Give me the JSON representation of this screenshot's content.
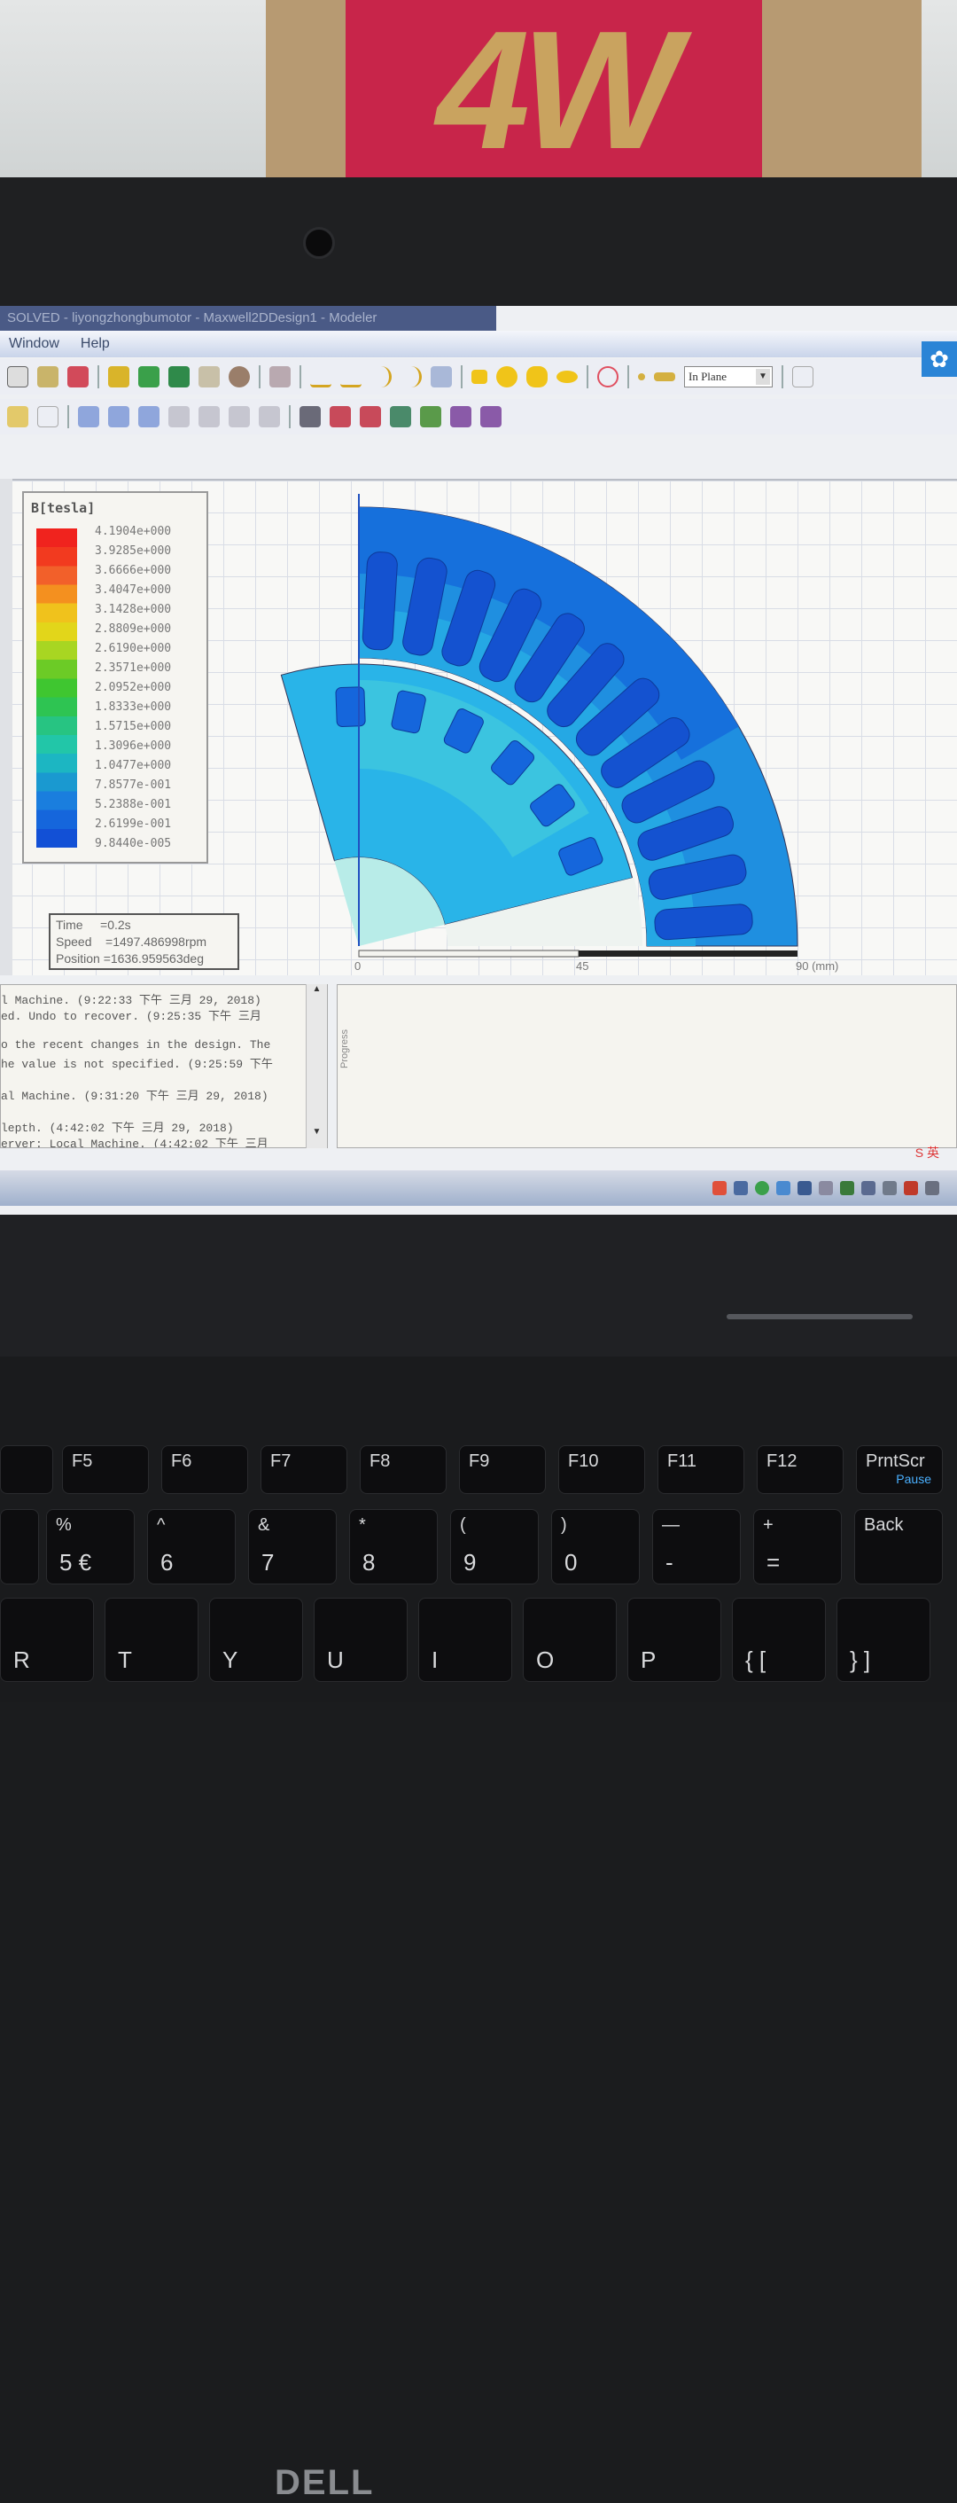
{
  "environment": {
    "box_label": "4W",
    "laptop_brand": "DELL"
  },
  "window": {
    "title": "SOLVED - liyongzhongbumotor - Maxwell2DDesign1 - Modeler"
  },
  "menu": [
    "Window",
    "Help"
  ],
  "toolbar": {
    "plane_select": "In Plane"
  },
  "legend": {
    "title": "B[tesla]",
    "values": [
      "4.1904e+000",
      "3.9285e+000",
      "3.6666e+000",
      "3.4047e+000",
      "3.1428e+000",
      "2.8809e+000",
      "2.6190e+000",
      "2.3571e+000",
      "2.0952e+000",
      "1.8333e+000",
      "1.5715e+000",
      "1.3096e+000",
      "1.0477e+000",
      "7.8577e-001",
      "5.2388e-001",
      "2.6199e-001",
      "9.8440e-005"
    ],
    "colors": [
      "#f0231e",
      "#f23a1f",
      "#f2602a",
      "#f4901f",
      "#f0c21c",
      "#e2d61a",
      "#a8d622",
      "#6ccb26",
      "#3fc630",
      "#2ec452",
      "#27c482",
      "#22c6a8",
      "#1cb6c2",
      "#1a99d0",
      "#1a7ede",
      "#1566dc",
      "#1250d6"
    ]
  },
  "info": {
    "time": "Time     =0.2s",
    "speed": "Speed    =1497.486998rpm",
    "position": "Position =1636.959563deg"
  },
  "scale": {
    "ticks": [
      "0",
      "45",
      "90 (mm)"
    ]
  },
  "log": {
    "lines": [
      "l Machine.  (9:22:33 下午  三月 29, 2018)",
      "ed. Undo to recover.  (9:25:35 下午  三月",
      "",
      "o the recent changes in the design.  The",
      "he value is not specified.  (9:25:59 下午",
      "",
      "al Machine.  (9:31:20 下午  三月 29, 2018)",
      "",
      "lepth.  (4:42:02 下午  三月 29, 2018)",
      "erver: Local Machine.  (4:42:02 下午  三月"
    ]
  },
  "progress": {
    "label": "Progress"
  },
  "ime": "S 英",
  "keyboard": {
    "fkeys": [
      "F5",
      "F6",
      "F7",
      "F8",
      "F9",
      "F10",
      "F11",
      "F12",
      "PrntScr"
    ],
    "fkey_sub": [
      "",
      "",
      "",
      "",
      "",
      "",
      "",
      "",
      "Pause"
    ],
    "numbers": [
      [
        "%",
        "5 €"
      ],
      [
        "^",
        "6"
      ],
      [
        "&",
        "7"
      ],
      [
        "*",
        "8"
      ],
      [
        "(",
        "9"
      ],
      [
        ")",
        "0"
      ],
      [
        "—",
        "-"
      ],
      [
        "+",
        "="
      ],
      [
        "Back",
        ""
      ]
    ],
    "letters": [
      "R",
      "T",
      "Y",
      "U",
      "I",
      "O",
      "P",
      "{ [",
      "} ]"
    ]
  }
}
